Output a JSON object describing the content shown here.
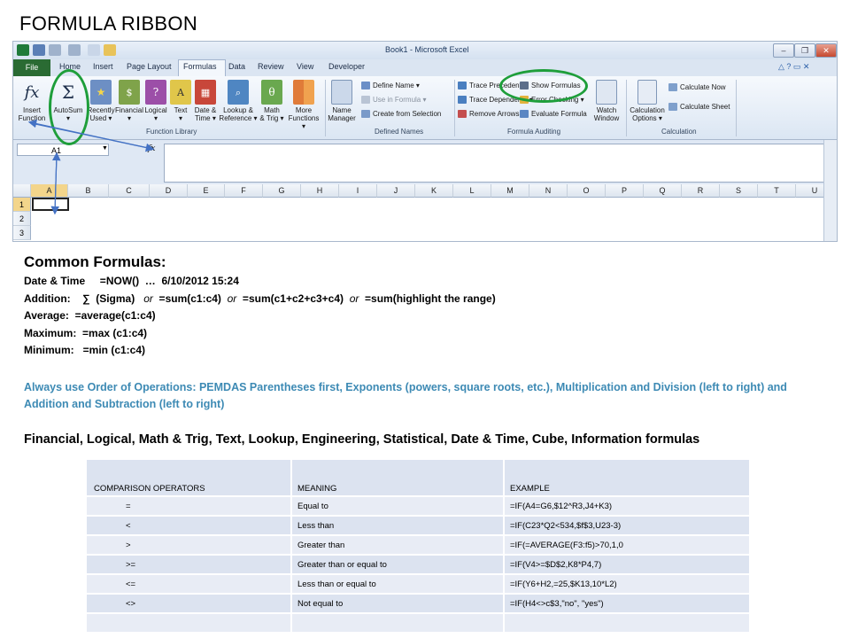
{
  "page_title": "FORMULA RIBBON",
  "excel": {
    "window_title": "Book1 - Microsoft Excel",
    "tabs": [
      "File",
      "Home",
      "Insert",
      "Page Layout",
      "Formulas",
      "Data",
      "Review",
      "View",
      "Developer"
    ],
    "function_library": {
      "buttons": [
        {
          "l1": "Insert",
          "l2": "Function",
          "icon": "fx-icon",
          "glyph": "fx"
        },
        {
          "l1": "AutoSum",
          "l2": "▾",
          "icon": "sigma-icon",
          "glyph": "Σ"
        },
        {
          "l1": "Recently",
          "l2": "Used ▾",
          "icon": "star-book-icon",
          "glyph": "★"
        },
        {
          "l1": "Financial",
          "l2": "▾",
          "icon": "book-icon",
          "glyph": "$"
        },
        {
          "l1": "Logical",
          "l2": "▾",
          "icon": "question-book-icon",
          "glyph": "?"
        },
        {
          "l1": "Text",
          "l2": "▾",
          "icon": "text-book-icon",
          "glyph": "A"
        },
        {
          "l1": "Date &",
          "l2": "Time ▾",
          "icon": "calendar-book-icon",
          "glyph": "▦"
        },
        {
          "l1": "Lookup &",
          "l2": "Reference ▾",
          "icon": "lookup-book-icon",
          "glyph": "⌕"
        },
        {
          "l1": "Math",
          "l2": "& Trig ▾",
          "icon": "theta-book-icon",
          "glyph": "θ"
        },
        {
          "l1": "More",
          "l2": "Functions ▾",
          "icon": "books-icon",
          "glyph": ""
        }
      ],
      "label": "Function Library"
    },
    "defined_names": {
      "name_manager": {
        "l1": "Name",
        "l2": "Manager"
      },
      "items": [
        "Define Name ▾",
        "Use in Formula ▾",
        "Create from Selection"
      ],
      "label": "Defined Names"
    },
    "formula_auditing": {
      "items_left": [
        "Trace Precedents",
        "Trace Dependents ▾",
        "Remove Arrows ▾"
      ],
      "items_right": [
        "Show Formulas",
        "Error Checking ▾",
        "Evaluate Formula"
      ],
      "watch": {
        "l1": "Watch",
        "l2": "Window"
      },
      "label": "Formula Auditing"
    },
    "calculation": {
      "options": {
        "l1": "Calculation",
        "l2": "Options ▾"
      },
      "items": [
        "Calculate Now",
        "Calculate Sheet"
      ],
      "label": "Calculation"
    },
    "name_box": "A1",
    "fx": "fx",
    "columns": [
      "A",
      "B",
      "C",
      "D",
      "E",
      "F",
      "G",
      "H",
      "I",
      "J",
      "K",
      "L",
      "M",
      "N",
      "O",
      "P",
      "Q",
      "R",
      "S",
      "T",
      "U"
    ],
    "rows": [
      "1",
      "2",
      "3"
    ]
  },
  "common_title": "Common Formulas:",
  "formula_lines": [
    {
      "a": "Date & Time     =NOW()  …  6/10/2012 15:24"
    },
    {
      "a": "Addition:    ∑  (Sigma)   ",
      "b": "or",
      "c": "  =sum(c1:c4)  ",
      "d": "or",
      "e": "  =sum(c1+c2+c3+c4)  ",
      "f": "or",
      "g": "  =sum(highlight the range)"
    },
    {
      "a": "Average:  =average(c1:c4)"
    },
    {
      "a": "Maximum:  =max (c1:c4)"
    },
    {
      "a": "Minimum:   =min (c1:c4)"
    }
  ],
  "pemdas": "Always use Order of Operations:  PEMDAS      Parentheses first, Exponents (powers, square roots, etc.), Multiplication and Division (left to right) and Addition and Subtraction (left to right)",
  "financial_line": "Financial, Logical, Math & Trig, Text, Lookup, Engineering, Statistical, Date & Time,  Cube, Information formulas",
  "table": {
    "headers": [
      "COMPARISON OPERATORS",
      "MEANING",
      "EXAMPLE"
    ],
    "rows": [
      [
        "=",
        "Equal to",
        "=IF(A4=G6,$12^R3,J4+K3)"
      ],
      [
        "<",
        "Less than",
        "=IF(C23*Q2<534,$f$3,U23-3)"
      ],
      [
        ">",
        "Greater than",
        "=IF(=AVERAGE(F3:f5)>70,1,0"
      ],
      [
        ">=",
        "Greater than or equal to",
        "=IF(V4>=$D$2,K8*P4,7)"
      ],
      [
        "<=",
        "Less than or equal to",
        "=IF(Y6+H2,=25,$K13,10*L2)"
      ],
      [
        "<>",
        "Not equal to",
        "=IF(H4<>c$3,\"no\", \"yes\")"
      ],
      [
        "",
        "",
        ""
      ]
    ]
  },
  "colors": {
    "accent_green": "#1e9e3a",
    "arrow_blue": "#4472c4",
    "pemdas_blue": "#3d8ab4"
  }
}
